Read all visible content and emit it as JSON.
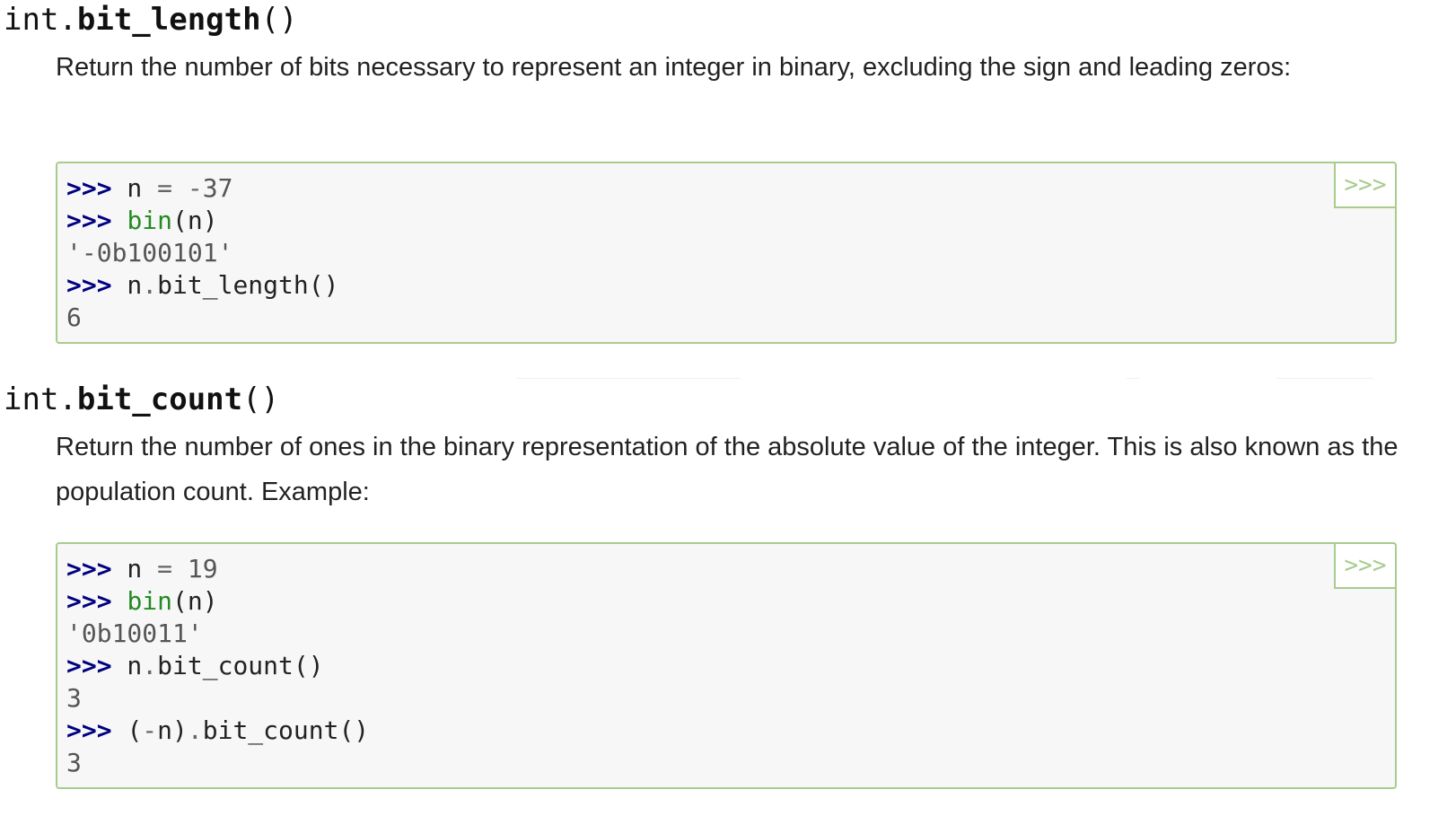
{
  "sections": [
    {
      "sig_prefix": "int.",
      "sig_name": "bit_length",
      "sig_paren": "()",
      "description": "Return the number of bits necessary to represent an integer in binary, excluding the sign and leading zeros:",
      "copy_label": ">>>",
      "code": [
        [
          "gp",
          ">>>"
        ],
        [
          "n",
          " n "
        ],
        [
          "o",
          "="
        ],
        [
          "n",
          " "
        ],
        [
          "o",
          "-"
        ],
        [
          "mi",
          "37"
        ],
        [
          "n",
          "\n"
        ],
        [
          "gp",
          ">>>"
        ],
        [
          "n",
          " "
        ],
        [
          "nb",
          "bin"
        ],
        [
          "p",
          "("
        ],
        [
          "n",
          "n"
        ],
        [
          "p",
          ")"
        ],
        [
          "n",
          "\n"
        ],
        [
          "go",
          "'-0b100101'"
        ],
        [
          "n",
          "\n"
        ],
        [
          "gp",
          ">>>"
        ],
        [
          "n",
          " n"
        ],
        [
          "o",
          "."
        ],
        [
          "n",
          "bit_length"
        ],
        [
          "p",
          "()"
        ],
        [
          "n",
          "\n"
        ],
        [
          "go",
          "6"
        ]
      ]
    },
    {
      "sig_prefix": "int.",
      "sig_name": "bit_count",
      "sig_paren": "()",
      "description": "Return the number of ones in the binary representation of the absolute value of the integer. This is also known as the population count. Example:",
      "copy_label": ">>>",
      "code": [
        [
          "gp",
          ">>>"
        ],
        [
          "n",
          " n "
        ],
        [
          "o",
          "="
        ],
        [
          "n",
          " "
        ],
        [
          "mi",
          "19"
        ],
        [
          "n",
          "\n"
        ],
        [
          "gp",
          ">>>"
        ],
        [
          "n",
          " "
        ],
        [
          "nb",
          "bin"
        ],
        [
          "p",
          "("
        ],
        [
          "n",
          "n"
        ],
        [
          "p",
          ")"
        ],
        [
          "n",
          "\n"
        ],
        [
          "go",
          "'0b10011'"
        ],
        [
          "n",
          "\n"
        ],
        [
          "gp",
          ">>>"
        ],
        [
          "n",
          " n"
        ],
        [
          "o",
          "."
        ],
        [
          "n",
          "bit_count"
        ],
        [
          "p",
          "()"
        ],
        [
          "n",
          "\n"
        ],
        [
          "go",
          "3"
        ],
        [
          "n",
          "\n"
        ],
        [
          "gp",
          ">>>"
        ],
        [
          "n",
          " "
        ],
        [
          "p",
          "("
        ],
        [
          "o",
          "-"
        ],
        [
          "n",
          "n"
        ],
        [
          "p",
          ")"
        ],
        [
          "o",
          "."
        ],
        [
          "n",
          "bit_count"
        ],
        [
          "p",
          "()"
        ],
        [
          "n",
          "\n"
        ],
        [
          "go",
          "3"
        ]
      ]
    }
  ]
}
